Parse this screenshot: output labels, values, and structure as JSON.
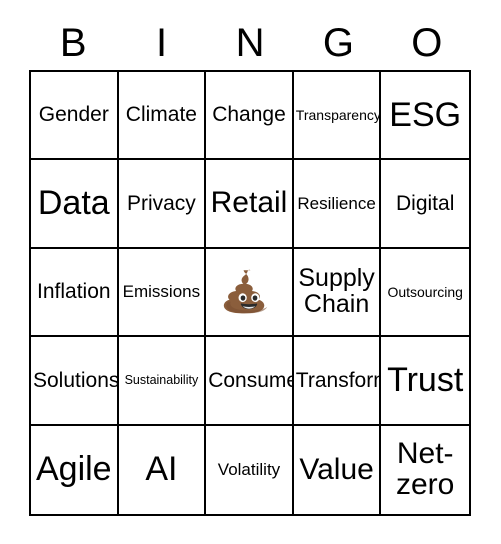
{
  "card": {
    "title_letters": [
      "B",
      "I",
      "N",
      "G",
      "O"
    ],
    "columns": 5,
    "rows": 5,
    "background_color": "#ffffff",
    "border_color": "#000000",
    "text_color": "#000000",
    "free_space": {
      "position": "center",
      "icon": "pile-of-poo-emoji",
      "glyph": "💩",
      "body_color": "#8B5E3C",
      "body_shadow_color": "#7A4F31",
      "eye_color": "#ffffff",
      "pupil_color": "#2B2B2B",
      "mouth_color": "#2B2B2B"
    },
    "cells": [
      [
        {
          "text": "Gender",
          "size": "md"
        },
        {
          "text": "Climate",
          "size": "md"
        },
        {
          "text": "Change",
          "size": "md"
        },
        {
          "text": "Transparency",
          "size": "xs"
        },
        {
          "text": "ESG",
          "size": "xxl"
        }
      ],
      [
        {
          "text": "Data",
          "size": "xxl"
        },
        {
          "text": "Privacy",
          "size": "md"
        },
        {
          "text": "Retail",
          "size": "xl"
        },
        {
          "text": "Resilience",
          "size": "sm"
        },
        {
          "text": "Digital",
          "size": "md"
        }
      ],
      [
        {
          "text": "Inflation",
          "size": "md"
        },
        {
          "text": "Emissions",
          "size": "sm"
        },
        {
          "text": "",
          "size": "md",
          "free": true
        },
        {
          "text": "Supply\nChain",
          "size": "lg"
        },
        {
          "text": "Outsourcing",
          "size": "xs"
        }
      ],
      [
        {
          "text": "Solutions",
          "size": "md"
        },
        {
          "text": "Sustainability",
          "size": "xxs"
        },
        {
          "text": "Consumer",
          "size": "md"
        },
        {
          "text": "Transform",
          "size": "md"
        },
        {
          "text": "Trust",
          "size": "xxl"
        }
      ],
      [
        {
          "text": "Agile",
          "size": "xxl"
        },
        {
          "text": "AI",
          "size": "xxl"
        },
        {
          "text": "Volatility",
          "size": "sm"
        },
        {
          "text": "Value",
          "size": "xl"
        },
        {
          "text": "Net-\nzero",
          "size": "xl"
        }
      ]
    ]
  }
}
